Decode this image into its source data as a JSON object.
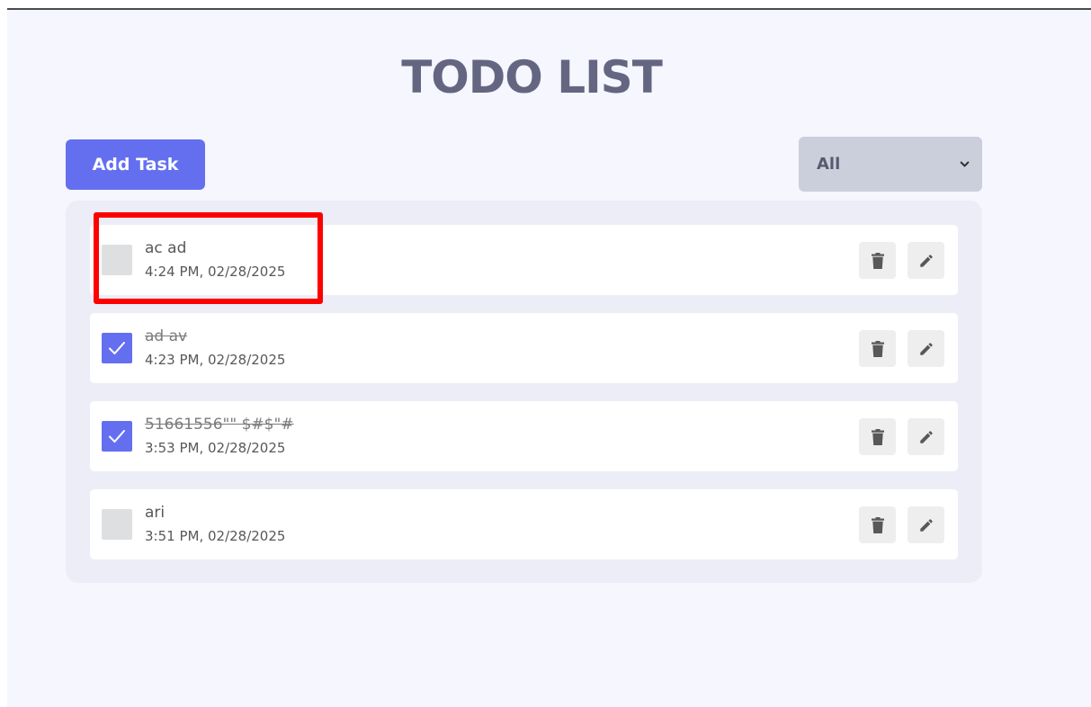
{
  "app": {
    "title": "TODO LIST"
  },
  "toolbar": {
    "add_label": "Add Task",
    "filter_value": "All"
  },
  "tasks": [
    {
      "title": "ac ad",
      "time": "4:24 PM, 02/28/2025",
      "completed": false
    },
    {
      "title": "ad av",
      "time": "4:23 PM, 02/28/2025",
      "completed": true
    },
    {
      "title": "51661556\"\" $#$\"#",
      "time": "3:53 PM, 02/28/2025",
      "completed": true
    },
    {
      "title": "ari",
      "time": "3:51 PM, 02/28/2025",
      "completed": false
    }
  ],
  "colors": {
    "accent": "#646ff0",
    "title": "#646681",
    "background": "#f5f6fe",
    "list_background": "#ecedf6",
    "highlight": "#ff0000"
  },
  "icons": {
    "delete": "trash-icon",
    "edit": "pencil-icon",
    "check": "check-icon",
    "dropdown": "chevron-down-icon"
  }
}
